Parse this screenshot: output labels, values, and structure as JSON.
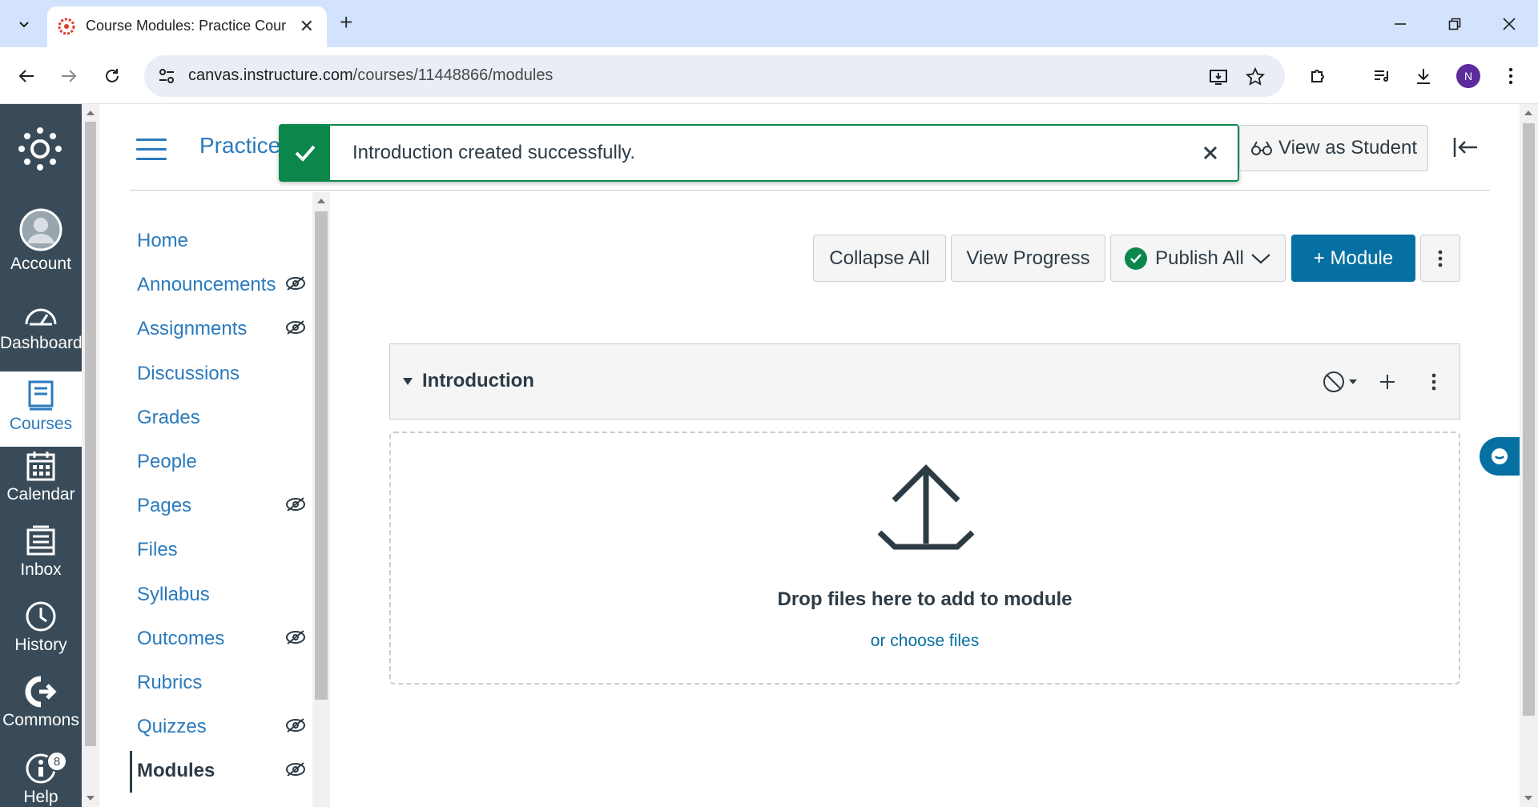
{
  "browser": {
    "tab_title": "Course Modules: Practice Cours",
    "url_host": "canvas.instructure.com",
    "url_path": "/courses/11448866/modules",
    "profile_initial": "N"
  },
  "global_nav": {
    "items": [
      {
        "label": "Account",
        "icon": "account-icon"
      },
      {
        "label": "Dashboard",
        "icon": "dashboard-icon"
      },
      {
        "label": "Courses",
        "icon": "courses-icon"
      },
      {
        "label": "Calendar",
        "icon": "calendar-icon"
      },
      {
        "label": "Inbox",
        "icon": "inbox-icon"
      },
      {
        "label": "History",
        "icon": "history-icon"
      },
      {
        "label": "Commons",
        "icon": "commons-icon"
      },
      {
        "label": "Help",
        "icon": "help-icon"
      }
    ],
    "help_badge": "8",
    "active": "Courses"
  },
  "header": {
    "breadcrumb": "Practice",
    "view_as_student": "View as Student"
  },
  "toast": {
    "message": "Introduction created successfully."
  },
  "course_nav": {
    "items": [
      {
        "label": "Home",
        "hidden": false
      },
      {
        "label": "Announcements",
        "hidden": true
      },
      {
        "label": "Assignments",
        "hidden": true
      },
      {
        "label": "Discussions",
        "hidden": false
      },
      {
        "label": "Grades",
        "hidden": false
      },
      {
        "label": "People",
        "hidden": false
      },
      {
        "label": "Pages",
        "hidden": true
      },
      {
        "label": "Files",
        "hidden": false
      },
      {
        "label": "Syllabus",
        "hidden": false
      },
      {
        "label": "Outcomes",
        "hidden": true
      },
      {
        "label": "Rubrics",
        "hidden": false
      },
      {
        "label": "Quizzes",
        "hidden": true
      },
      {
        "label": "Modules",
        "hidden": true
      }
    ],
    "active": "Modules"
  },
  "toolbar": {
    "collapse_all": "Collapse All",
    "view_progress": "View Progress",
    "publish_all": "Publish All",
    "add_module": "+ Module"
  },
  "module": {
    "title": "Introduction",
    "drop_title": "Drop files here to add to module",
    "drop_link": "or choose files"
  },
  "colors": {
    "brand_blue": "#0770a3",
    "link_blue": "#2b7abc",
    "success_green": "#0b874b",
    "nav_dark": "#394b58"
  }
}
